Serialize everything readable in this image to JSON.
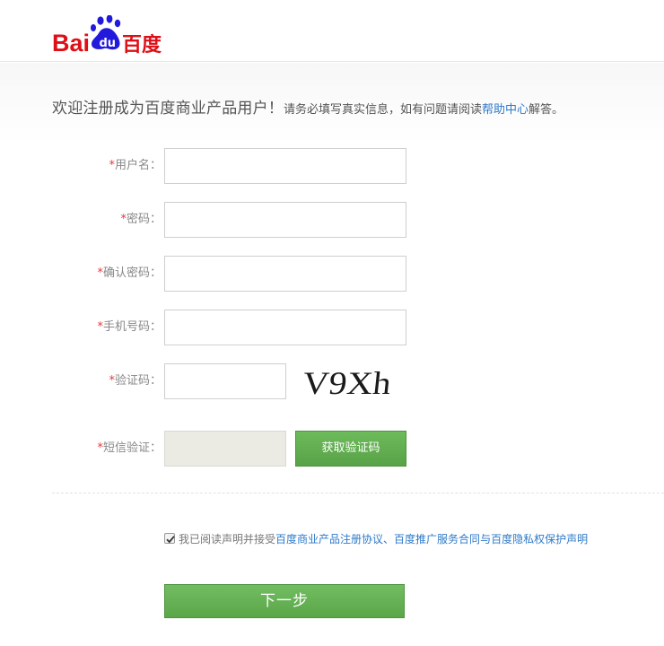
{
  "logo": {
    "text_bai": "Bai",
    "text_du": "du",
    "text_cn": "百度"
  },
  "welcome": {
    "title": "欢迎注册成为百度商业产品用户！",
    "sub_before": "请务必填写真实信息，如有问题请阅读",
    "help_link": "帮助中心",
    "sub_after": "解答。"
  },
  "form": {
    "required_mark": "*",
    "username_label": "用户名：",
    "password_label": "密码：",
    "confirm_password_label": "确认密码：",
    "phone_label": "手机号码：",
    "captcha_label": "验证码：",
    "captcha_text": "V9Xh",
    "sms_label": "短信验证：",
    "sms_button": "获取验证码"
  },
  "agreement": {
    "checked": true,
    "prefix": "我已阅读声明并接受",
    "link1": "百度商业产品注册协议",
    "sep": "、",
    "link2": "百度推广服务合同",
    "and": "与",
    "link3": "百度隐私权保护声明"
  },
  "next_button": "下一步",
  "colors": {
    "brand_red": "#de0f17",
    "brand_blue": "#2319dc",
    "link": "#2e7ac9",
    "button_green": "#5aa649",
    "required": "#e4393c"
  }
}
